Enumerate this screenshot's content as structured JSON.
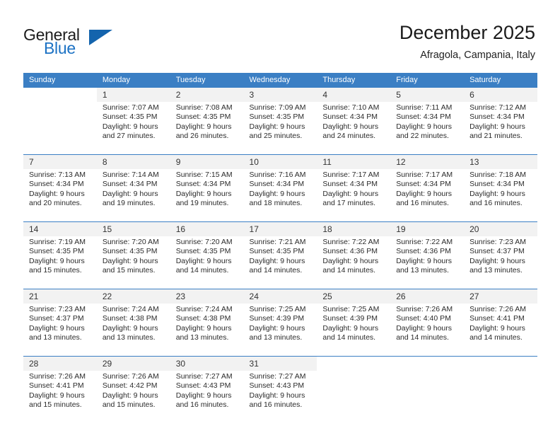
{
  "brand": {
    "name_primary": "General",
    "name_secondary": "Blue",
    "primary_color": "#1c1c1c",
    "secondary_color": "#1c72c4",
    "triangle_color": "#1464ad"
  },
  "header": {
    "title": "December 2025",
    "subtitle": "Afragola, Campania, Italy"
  },
  "theme": {
    "header_row_bg": "#3b7fc4",
    "day_number_bg": "#f2f2f2",
    "rule_color": "#3b7fc4"
  },
  "columns": [
    "Sunday",
    "Monday",
    "Tuesday",
    "Wednesday",
    "Thursday",
    "Friday",
    "Saturday"
  ],
  "weeks": [
    {
      "days": [
        {
          "number": "",
          "lines": []
        },
        {
          "number": "1",
          "lines": [
            "Sunrise: 7:07 AM",
            "Sunset: 4:35 PM",
            "Daylight: 9 hours",
            "and 27 minutes."
          ]
        },
        {
          "number": "2",
          "lines": [
            "Sunrise: 7:08 AM",
            "Sunset: 4:35 PM",
            "Daylight: 9 hours",
            "and 26 minutes."
          ]
        },
        {
          "number": "3",
          "lines": [
            "Sunrise: 7:09 AM",
            "Sunset: 4:35 PM",
            "Daylight: 9 hours",
            "and 25 minutes."
          ]
        },
        {
          "number": "4",
          "lines": [
            "Sunrise: 7:10 AM",
            "Sunset: 4:34 PM",
            "Daylight: 9 hours",
            "and 24 minutes."
          ]
        },
        {
          "number": "5",
          "lines": [
            "Sunrise: 7:11 AM",
            "Sunset: 4:34 PM",
            "Daylight: 9 hours",
            "and 22 minutes."
          ]
        },
        {
          "number": "6",
          "lines": [
            "Sunrise: 7:12 AM",
            "Sunset: 4:34 PM",
            "Daylight: 9 hours",
            "and 21 minutes."
          ]
        }
      ]
    },
    {
      "days": [
        {
          "number": "7",
          "lines": [
            "Sunrise: 7:13 AM",
            "Sunset: 4:34 PM",
            "Daylight: 9 hours",
            "and 20 minutes."
          ]
        },
        {
          "number": "8",
          "lines": [
            "Sunrise: 7:14 AM",
            "Sunset: 4:34 PM",
            "Daylight: 9 hours",
            "and 19 minutes."
          ]
        },
        {
          "number": "9",
          "lines": [
            "Sunrise: 7:15 AM",
            "Sunset: 4:34 PM",
            "Daylight: 9 hours",
            "and 19 minutes."
          ]
        },
        {
          "number": "10",
          "lines": [
            "Sunrise: 7:16 AM",
            "Sunset: 4:34 PM",
            "Daylight: 9 hours",
            "and 18 minutes."
          ]
        },
        {
          "number": "11",
          "lines": [
            "Sunrise: 7:17 AM",
            "Sunset: 4:34 PM",
            "Daylight: 9 hours",
            "and 17 minutes."
          ]
        },
        {
          "number": "12",
          "lines": [
            "Sunrise: 7:17 AM",
            "Sunset: 4:34 PM",
            "Daylight: 9 hours",
            "and 16 minutes."
          ]
        },
        {
          "number": "13",
          "lines": [
            "Sunrise: 7:18 AM",
            "Sunset: 4:34 PM",
            "Daylight: 9 hours",
            "and 16 minutes."
          ]
        }
      ]
    },
    {
      "days": [
        {
          "number": "14",
          "lines": [
            "Sunrise: 7:19 AM",
            "Sunset: 4:35 PM",
            "Daylight: 9 hours",
            "and 15 minutes."
          ]
        },
        {
          "number": "15",
          "lines": [
            "Sunrise: 7:20 AM",
            "Sunset: 4:35 PM",
            "Daylight: 9 hours",
            "and 15 minutes."
          ]
        },
        {
          "number": "16",
          "lines": [
            "Sunrise: 7:20 AM",
            "Sunset: 4:35 PM",
            "Daylight: 9 hours",
            "and 14 minutes."
          ]
        },
        {
          "number": "17",
          "lines": [
            "Sunrise: 7:21 AM",
            "Sunset: 4:35 PM",
            "Daylight: 9 hours",
            "and 14 minutes."
          ]
        },
        {
          "number": "18",
          "lines": [
            "Sunrise: 7:22 AM",
            "Sunset: 4:36 PM",
            "Daylight: 9 hours",
            "and 14 minutes."
          ]
        },
        {
          "number": "19",
          "lines": [
            "Sunrise: 7:22 AM",
            "Sunset: 4:36 PM",
            "Daylight: 9 hours",
            "and 13 minutes."
          ]
        },
        {
          "number": "20",
          "lines": [
            "Sunrise: 7:23 AM",
            "Sunset: 4:37 PM",
            "Daylight: 9 hours",
            "and 13 minutes."
          ]
        }
      ]
    },
    {
      "days": [
        {
          "number": "21",
          "lines": [
            "Sunrise: 7:23 AM",
            "Sunset: 4:37 PM",
            "Daylight: 9 hours",
            "and 13 minutes."
          ]
        },
        {
          "number": "22",
          "lines": [
            "Sunrise: 7:24 AM",
            "Sunset: 4:38 PM",
            "Daylight: 9 hours",
            "and 13 minutes."
          ]
        },
        {
          "number": "23",
          "lines": [
            "Sunrise: 7:24 AM",
            "Sunset: 4:38 PM",
            "Daylight: 9 hours",
            "and 13 minutes."
          ]
        },
        {
          "number": "24",
          "lines": [
            "Sunrise: 7:25 AM",
            "Sunset: 4:39 PM",
            "Daylight: 9 hours",
            "and 13 minutes."
          ]
        },
        {
          "number": "25",
          "lines": [
            "Sunrise: 7:25 AM",
            "Sunset: 4:39 PM",
            "Daylight: 9 hours",
            "and 14 minutes."
          ]
        },
        {
          "number": "26",
          "lines": [
            "Sunrise: 7:26 AM",
            "Sunset: 4:40 PM",
            "Daylight: 9 hours",
            "and 14 minutes."
          ]
        },
        {
          "number": "27",
          "lines": [
            "Sunrise: 7:26 AM",
            "Sunset: 4:41 PM",
            "Daylight: 9 hours",
            "and 14 minutes."
          ]
        }
      ]
    },
    {
      "days": [
        {
          "number": "28",
          "lines": [
            "Sunrise: 7:26 AM",
            "Sunset: 4:41 PM",
            "Daylight: 9 hours",
            "and 15 minutes."
          ]
        },
        {
          "number": "29",
          "lines": [
            "Sunrise: 7:26 AM",
            "Sunset: 4:42 PM",
            "Daylight: 9 hours",
            "and 15 minutes."
          ]
        },
        {
          "number": "30",
          "lines": [
            "Sunrise: 7:27 AM",
            "Sunset: 4:43 PM",
            "Daylight: 9 hours",
            "and 16 minutes."
          ]
        },
        {
          "number": "31",
          "lines": [
            "Sunrise: 7:27 AM",
            "Sunset: 4:43 PM",
            "Daylight: 9 hours",
            "and 16 minutes."
          ]
        },
        {
          "number": "",
          "lines": []
        },
        {
          "number": "",
          "lines": []
        },
        {
          "number": "",
          "lines": []
        }
      ]
    }
  ]
}
